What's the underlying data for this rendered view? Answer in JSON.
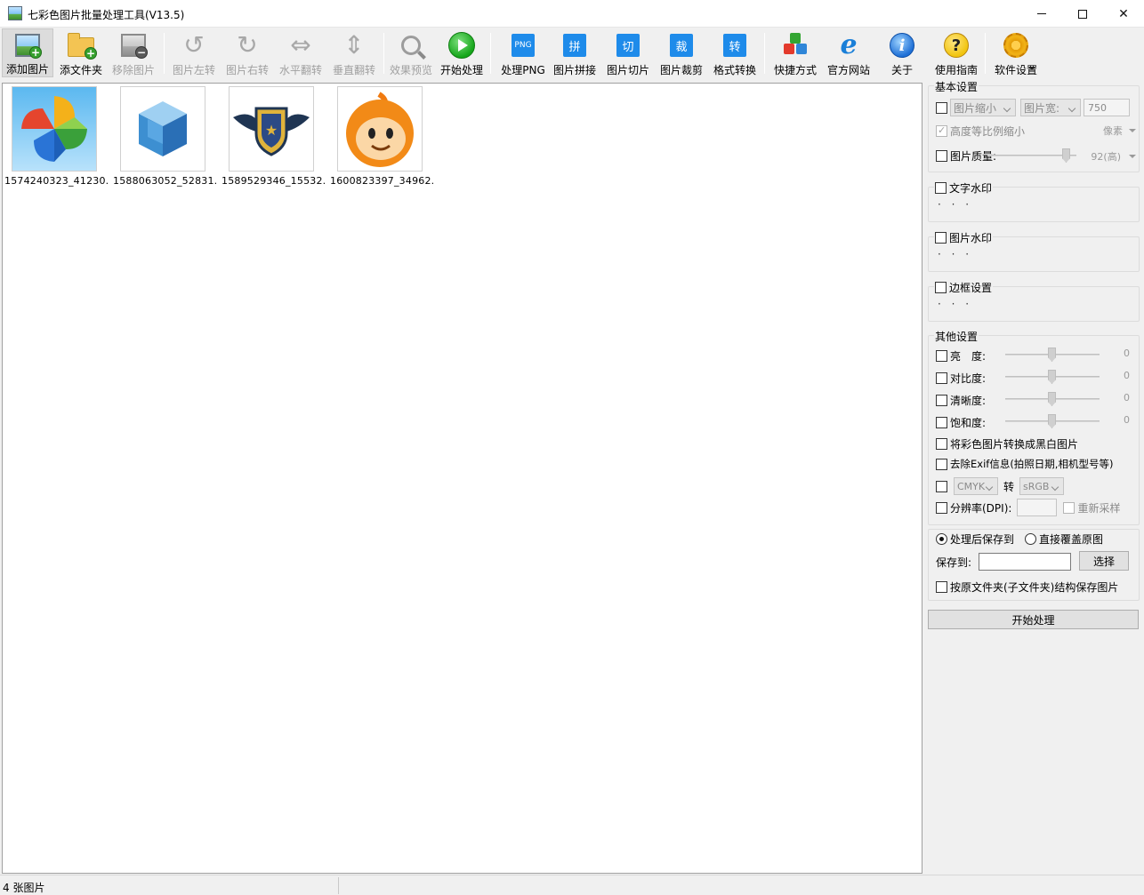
{
  "window": {
    "title": "七彩色图片批量处理工具(V13.5)",
    "minimize": "minimize",
    "maximize": "maximize",
    "close": "✕"
  },
  "toolbar": {
    "add_image": "添加图片",
    "add_folder": "添文件夹",
    "remove_image": "移除图片",
    "rotate_left": "图片左转",
    "rotate_right": "图片右转",
    "flip_horizontal": "水平翻转",
    "flip_vertical": "垂直翻转",
    "preview": "效果预览",
    "start": "开始处理",
    "png_icon_text": "PNG",
    "process_png": "处理PNG",
    "stitch_icon_text": "拼",
    "stitch": "图片拼接",
    "slice_icon_text": "切",
    "slice": "图片切片",
    "crop_icon_text": "裁",
    "crop": "图片裁剪",
    "convert_icon_text": "转",
    "convert": "格式转换",
    "shortcut": "快捷方式",
    "website": "官方网站",
    "about": "关于",
    "guide": "使用指南",
    "settings": "软件设置",
    "colors": {
      "accent_blue": "#1e8bea",
      "play_green": "#15a61a"
    }
  },
  "images": [
    {
      "caption": "1574240323_41230..."
    },
    {
      "caption": "1588063052_52831..."
    },
    {
      "caption": "1589529346_15532..."
    },
    {
      "caption": "1600823397_34962..."
    }
  ],
  "basic": {
    "title": "基本设置",
    "resize_option": "图片缩小",
    "width_option": "图片宽:",
    "width_value": "750",
    "keep_ratio": "高度等比例缩小",
    "unit": "像素",
    "quality_label": "图片质量:",
    "quality_value": "92(高)",
    "quality_percent": 0.92
  },
  "text_watermark": {
    "title": "文字水印",
    "dots": "· · ·"
  },
  "image_watermark": {
    "title": "图片水印",
    "dots": "· · ·"
  },
  "border": {
    "title": "边框设置",
    "dots": "· · ·"
  },
  "other": {
    "title": "其他设置",
    "brightness": "亮　度:",
    "brightness_value": "0",
    "contrast": "对比度:",
    "contrast_value": "0",
    "sharpness": "清晰度:",
    "sharpness_value": "0",
    "saturation": "饱和度:",
    "saturation_value": "0",
    "grayscale": "将彩色图片转换成黑白图片",
    "remove_exif": "去除Exif信息(拍照日期,相机型号等)",
    "color_from": "CMYK",
    "to": "转",
    "color_to": "sRGB",
    "dpi": "分辨率(DPI):",
    "resample": "重新采样"
  },
  "output": {
    "save_after": "处理后保存到",
    "overwrite": "直接覆盖原图",
    "save_to": "保存到:",
    "save_path": "",
    "choose": "选择",
    "keep_structure": "按原文件夹(子文件夹)结构保存图片"
  },
  "start_button": "开始处理",
  "status": {
    "count": "4 张图片"
  }
}
